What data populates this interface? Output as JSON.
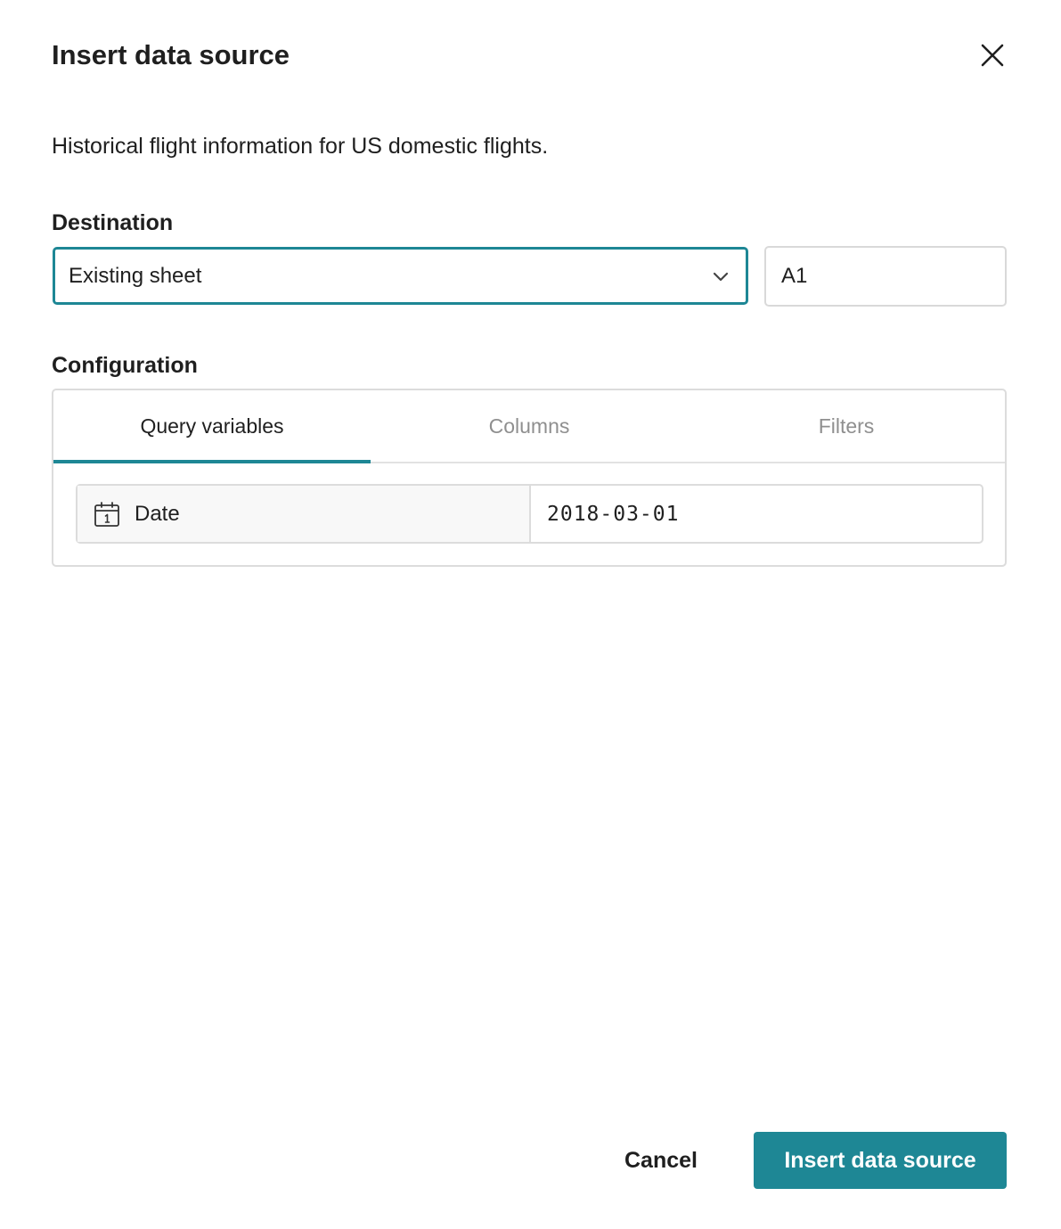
{
  "dialog": {
    "title": "Insert data source",
    "description": "Historical flight information for US domestic flights."
  },
  "destination": {
    "label": "Destination",
    "select_value": "Existing sheet",
    "cell_value": "A1"
  },
  "configuration": {
    "label": "Configuration",
    "tabs": [
      {
        "label": "Query variables",
        "active": true
      },
      {
        "label": "Columns",
        "active": false
      },
      {
        "label": "Filters",
        "active": false
      }
    ],
    "variables": [
      {
        "name": "Date",
        "icon": "calendar-icon",
        "value": "2018-03-01"
      }
    ]
  },
  "footer": {
    "cancel_label": "Cancel",
    "submit_label": "Insert data source"
  },
  "colors": {
    "accent": "#1e8795",
    "inactive_text": "#8f8f8f"
  }
}
